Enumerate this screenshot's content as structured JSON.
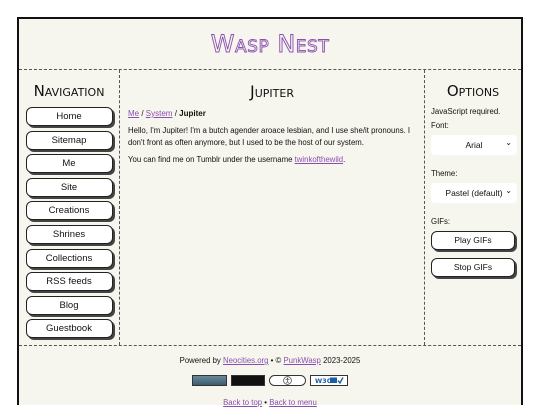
{
  "header": {
    "site_title": "Wasp Nest"
  },
  "nav": {
    "heading": "Navigation",
    "items": [
      "Home",
      "Sitemap",
      "Me",
      "Site",
      "Creations",
      "Shrines",
      "Collections",
      "RSS feeds",
      "Blog",
      "Guestbook"
    ]
  },
  "main": {
    "title": "Jupiter",
    "breadcrumb": {
      "link1": "Me",
      "sep1": " / ",
      "link2": "System",
      "sep2": " / ",
      "current": "Jupiter"
    },
    "para1": "Hello, I'm Jupiter! I'm a butch agender aroace lesbian, and I use she/it pronouns. I don't front as often anymore, but I used to be the host of our system.",
    "para2_prefix": "You can find me on Tumblr under the username ",
    "para2_link": "twinkofthewild",
    "para2_suffix": "."
  },
  "options": {
    "heading": "Options",
    "js_note": "JavaScript required.",
    "font_label": "Font:",
    "font_value": "Arial",
    "theme_label": "Theme:",
    "theme_value": "Pastel (default)",
    "gifs_label": "GIFs:",
    "play_gifs": "Play GIFs",
    "stop_gifs": "Stop GIFs"
  },
  "footer": {
    "powered_prefix": "Powered by ",
    "powered_link": "Neocities.org",
    "powered_mid": " • © ",
    "author_link": "PunkWasp",
    "years": " 2023-2025",
    "back_to_top": "Back to top",
    "link_sep": " • ",
    "back_to_menu": "Back to menu"
  },
  "colors": {
    "accent": "#8a4fb0",
    "panel_bg": "#f6f6ee"
  }
}
